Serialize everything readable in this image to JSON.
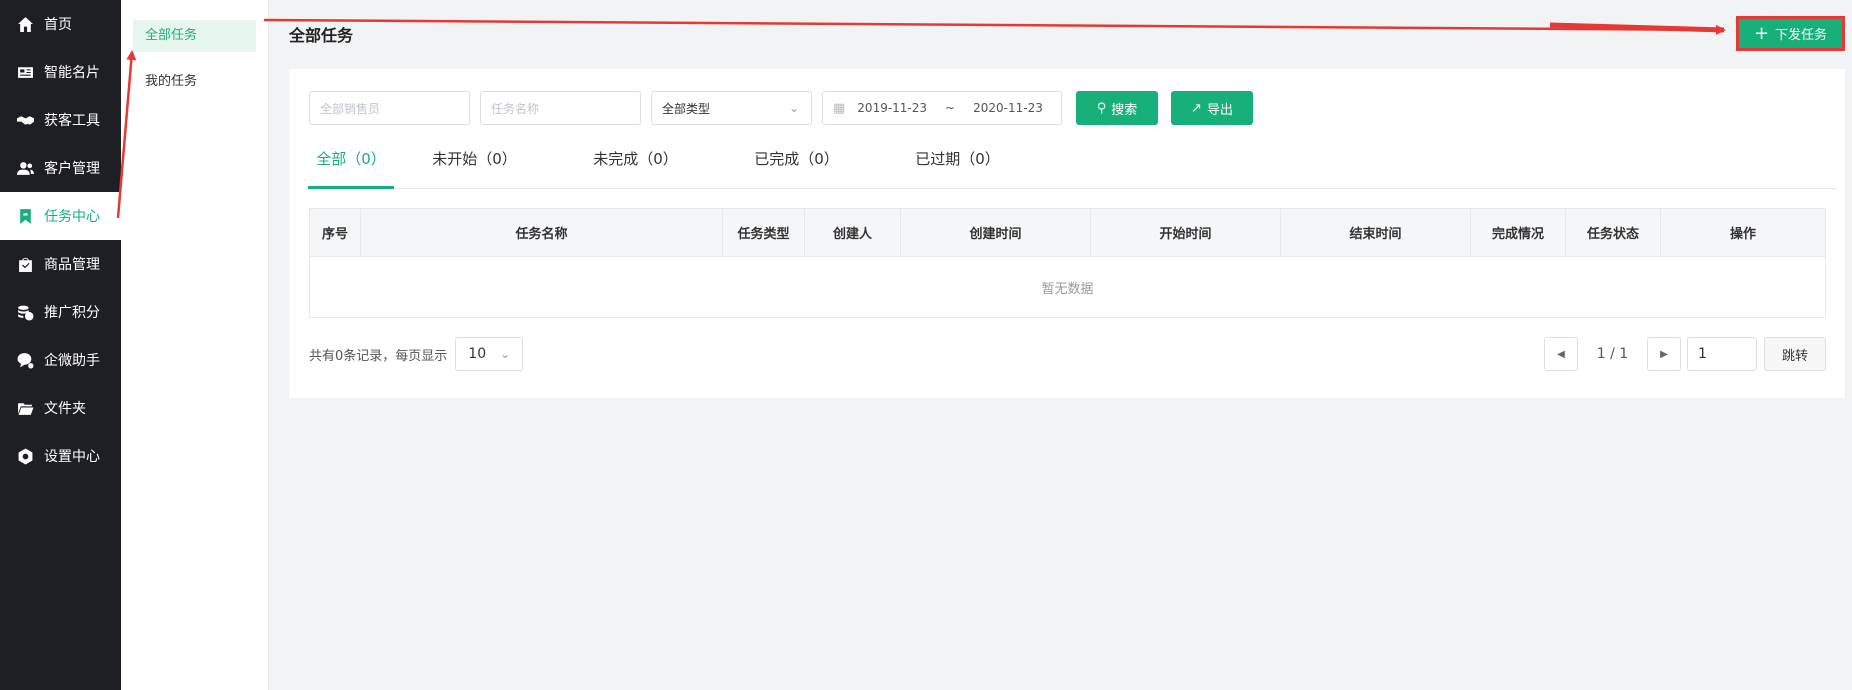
{
  "nav": {
    "items": [
      {
        "label": "首页",
        "icon": "home-icon"
      },
      {
        "label": "智能名片",
        "icon": "card-icon"
      },
      {
        "label": "获客工具",
        "icon": "handshake-icon"
      },
      {
        "label": "客户管理",
        "icon": "users-icon"
      },
      {
        "label": "任务中心",
        "icon": "bookmark-icon",
        "active": true
      },
      {
        "label": "商品管理",
        "icon": "bag-icon"
      },
      {
        "label": "推广积分",
        "icon": "coins-icon"
      },
      {
        "label": "企微助手",
        "icon": "chat-icon"
      },
      {
        "label": "文件夹",
        "icon": "folder-icon"
      },
      {
        "label": "设置中心",
        "icon": "gear-icon"
      }
    ]
  },
  "subnav": {
    "items": [
      {
        "label": "全部任务",
        "active": true
      },
      {
        "label": "我的任务"
      }
    ]
  },
  "header": {
    "title": "全部任务",
    "issue_button": "下发任务"
  },
  "filters": {
    "salesperson_placeholder": "全部销售员",
    "task_name_placeholder": "任务名称",
    "type_select_value": "全部类型",
    "date_start": "2019-11-23",
    "date_separator": "~",
    "date_end": "2020-11-23",
    "search_button": "搜索",
    "export_button": "导出"
  },
  "tabs": [
    {
      "label": "全部（0）",
      "active": true
    },
    {
      "label": "未开始（0）"
    },
    {
      "label": "未完成（0）"
    },
    {
      "label": "已完成（0）"
    },
    {
      "label": "已过期（0）"
    }
  ],
  "table": {
    "columns": [
      "序号",
      "任务名称",
      "任务类型",
      "创建人",
      "创建时间",
      "开始时间",
      "结束时间",
      "完成情况",
      "任务状态",
      "操作"
    ],
    "empty_text": "暂无数据"
  },
  "pagination": {
    "total_text": "共有0条记录，每页显示",
    "page_size": "10",
    "page_info": "1 / 1",
    "jump_input_value": "1",
    "jump_button": "跳转"
  },
  "colors": {
    "accent": "#18b07a",
    "nav_bg": "#1e1f24",
    "annotation_red": "#e53935"
  }
}
